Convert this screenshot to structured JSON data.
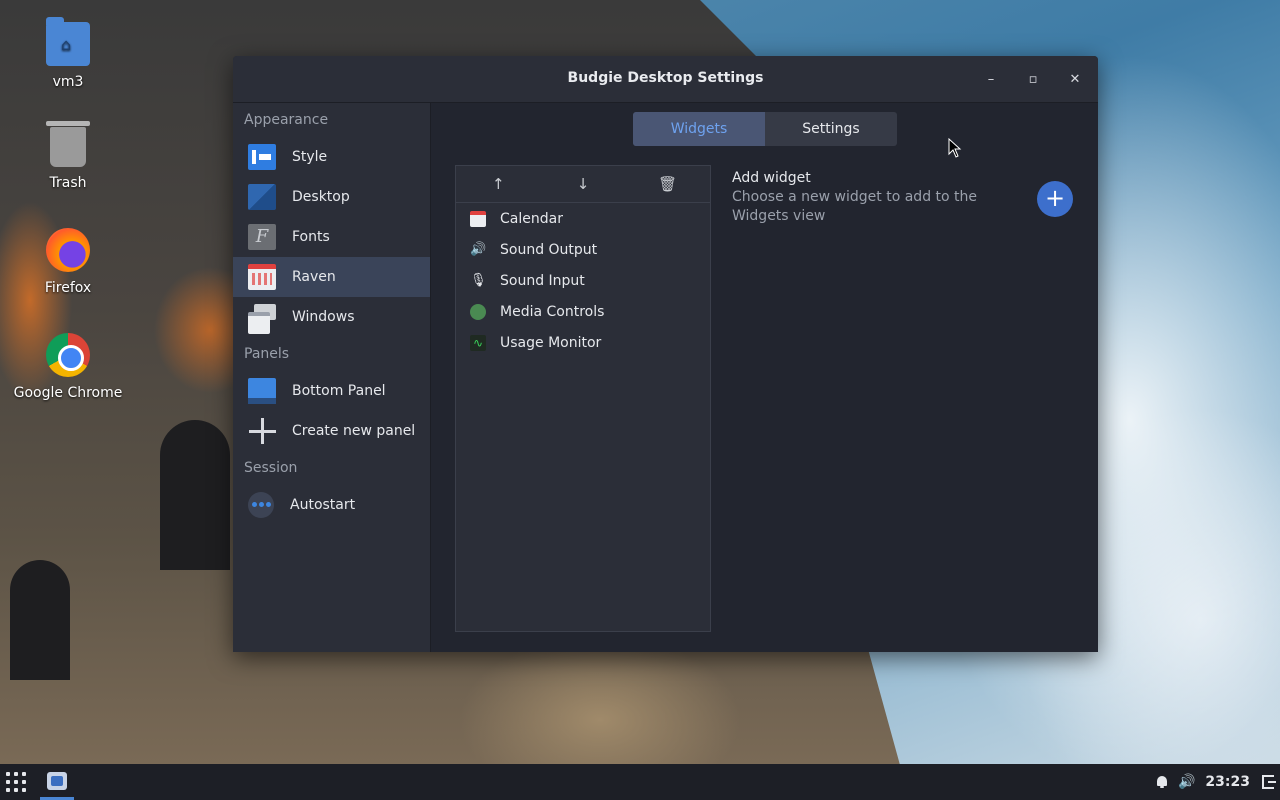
{
  "desktop": {
    "icons": [
      {
        "label": "vm3",
        "icon": "folder-home-icon"
      },
      {
        "label": "Trash",
        "icon": "trash-icon"
      },
      {
        "label": "Firefox",
        "icon": "firefox-icon"
      },
      {
        "label": "Google Chrome",
        "icon": "chrome-icon"
      }
    ]
  },
  "window": {
    "title": "Budgie Desktop Settings",
    "minimize_glyph": "–",
    "maximize_glyph": "▫",
    "close_glyph": "✕"
  },
  "sidebar": {
    "sections": [
      {
        "header": "Appearance",
        "items": [
          {
            "label": "Style",
            "icon": "style-icon"
          },
          {
            "label": "Desktop",
            "icon": "desktop-icon"
          },
          {
            "label": "Fonts",
            "icon": "fonts-icon",
            "glyph": "F"
          },
          {
            "label": "Raven",
            "icon": "raven-icon",
            "active": true
          },
          {
            "label": "Windows",
            "icon": "windows-icon"
          }
        ]
      },
      {
        "header": "Panels",
        "items": [
          {
            "label": "Bottom Panel",
            "icon": "bottom-panel-icon"
          },
          {
            "label": "Create new panel",
            "icon": "plus-icon"
          }
        ]
      },
      {
        "header": "Session",
        "items": [
          {
            "label": "Autostart",
            "icon": "autostart-icon"
          }
        ]
      }
    ]
  },
  "tabs": [
    {
      "label": "Widgets",
      "active": true
    },
    {
      "label": "Settings",
      "active": false
    }
  ],
  "widget_toolbar": {
    "up_glyph": "↑",
    "down_glyph": "↓",
    "delete_glyph": "🗑"
  },
  "widgets": [
    {
      "label": "Calendar",
      "icon": "calendar-icon"
    },
    {
      "label": "Sound Output",
      "icon": "speaker-icon",
      "glyph": "🔊"
    },
    {
      "label": "Sound Input",
      "icon": "microphone-icon",
      "glyph": "🎙"
    },
    {
      "label": "Media Controls",
      "icon": "media-controls-icon"
    },
    {
      "label": "Usage Monitor",
      "icon": "usage-monitor-icon",
      "glyph": "∿"
    }
  ],
  "add_widget": {
    "title": "Add widget",
    "description": "Choose a new widget to add to the Widgets view",
    "button_glyph": "+"
  },
  "taskbar": {
    "clock": "23:23",
    "volume_glyph": "🔊"
  },
  "colors": {
    "accent": "#3d6fcc",
    "active_tab_text": "#6ea2ef",
    "window_bg": "#22252f",
    "sidebar_bg": "#2b2e38"
  }
}
